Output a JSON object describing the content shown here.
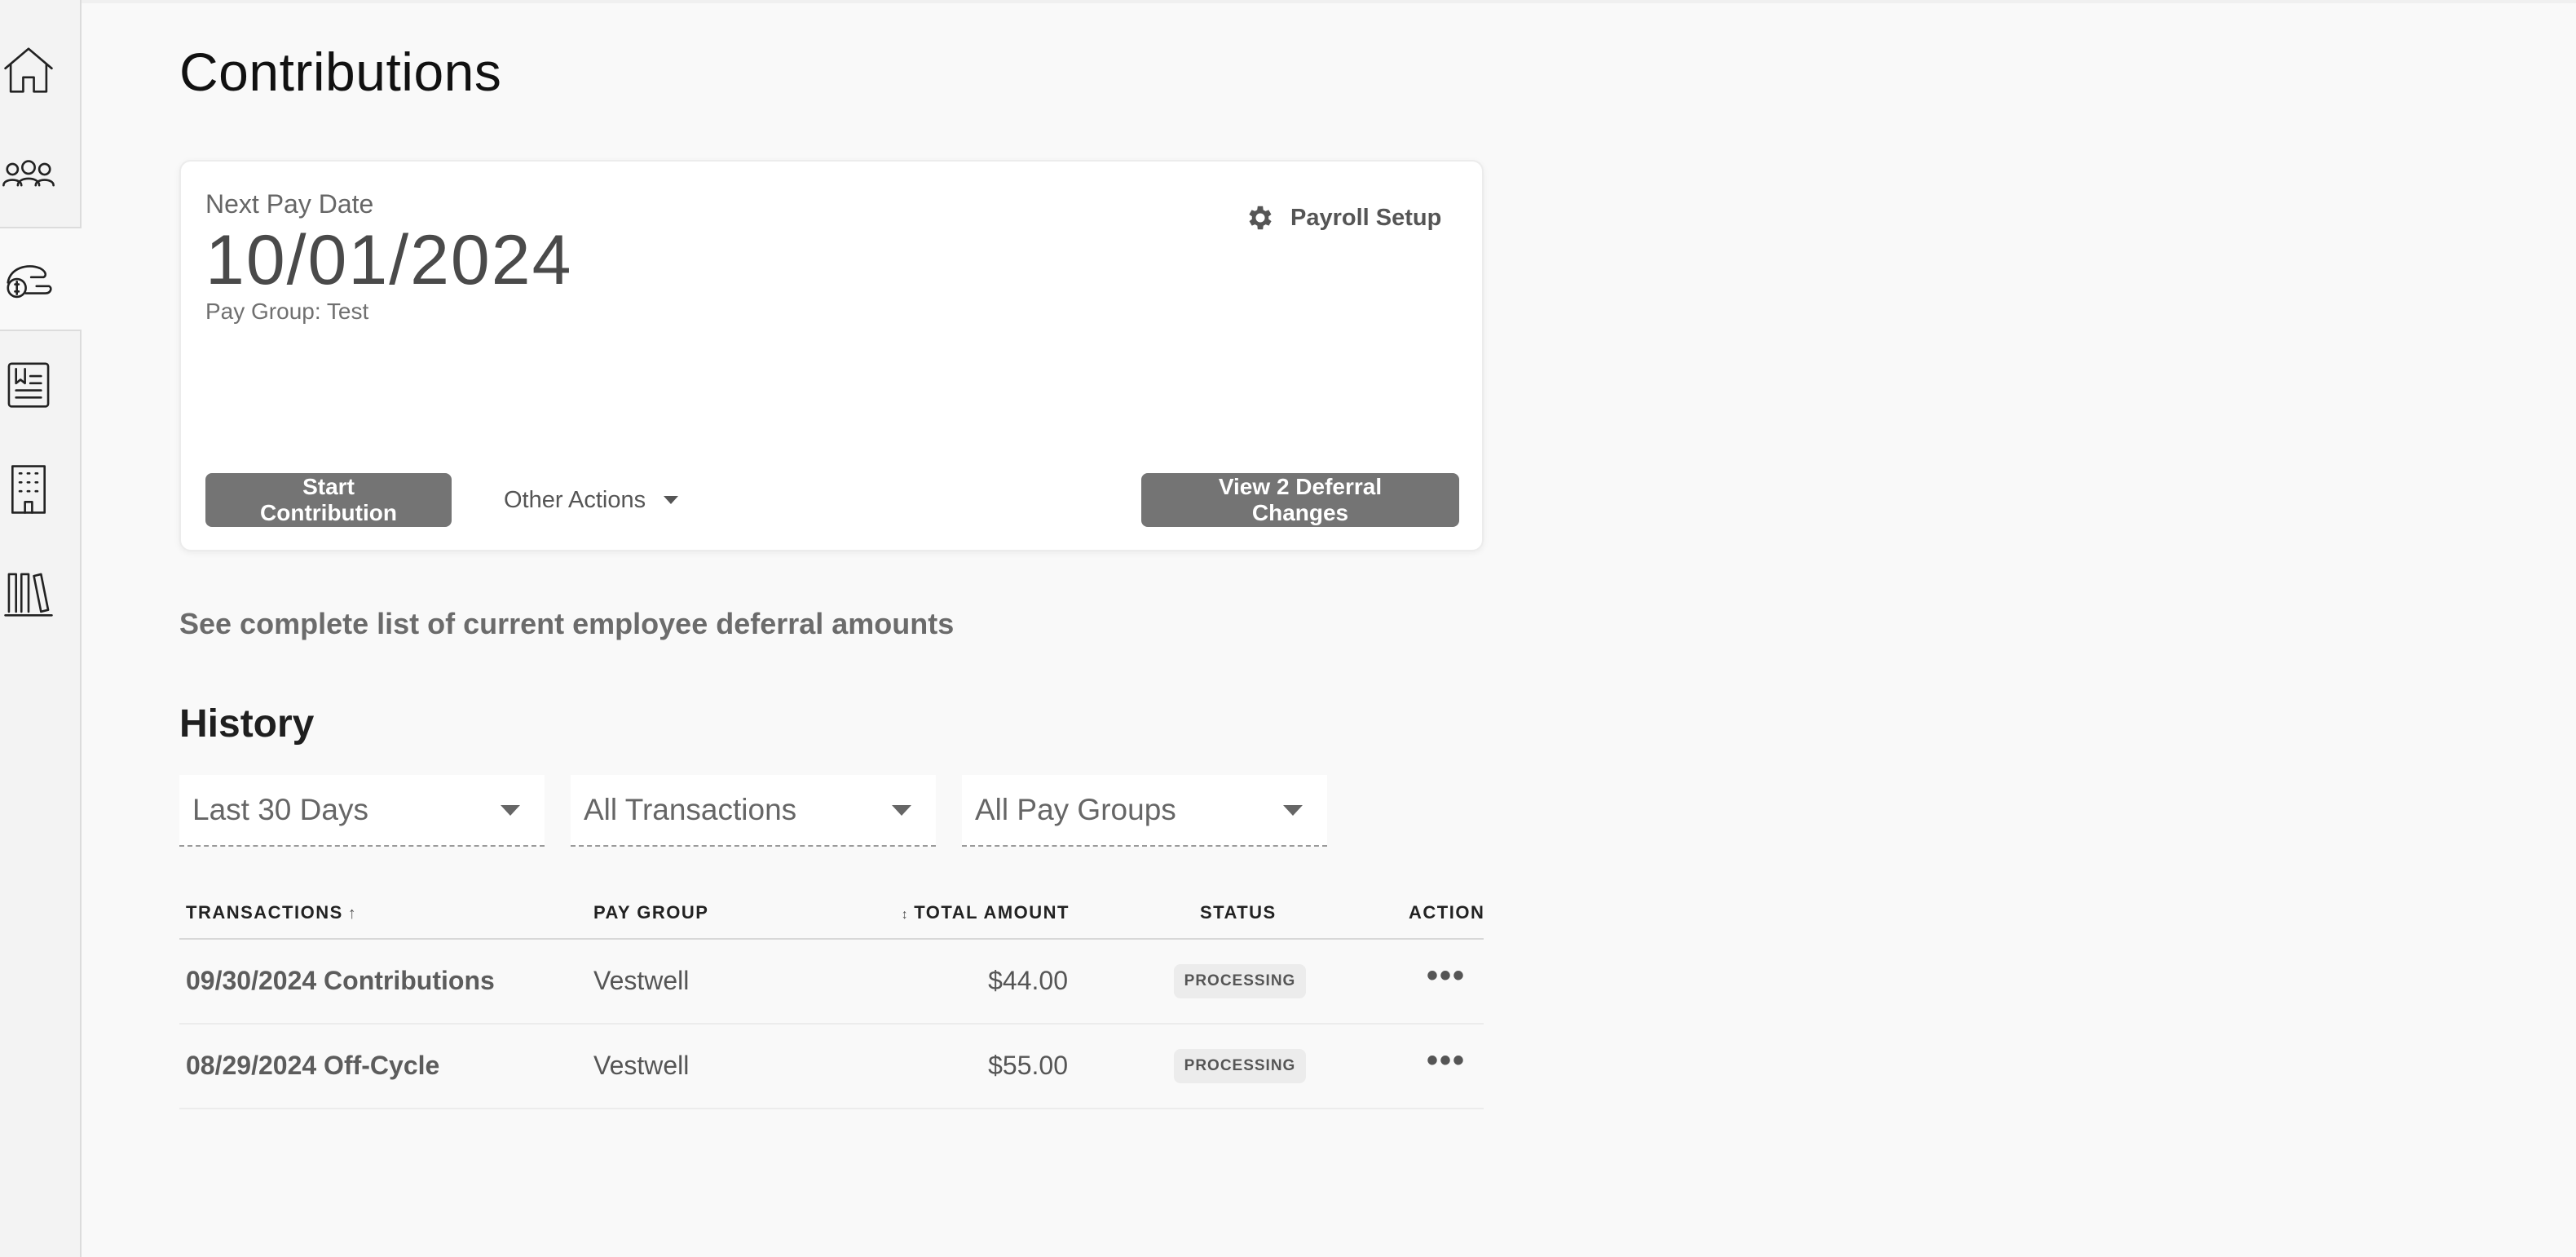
{
  "page": {
    "title": "Contributions"
  },
  "sidebar": {
    "items": [
      {
        "icon": "home-icon"
      },
      {
        "icon": "people-icon"
      },
      {
        "icon": "contributions-icon",
        "active": true
      },
      {
        "icon": "document-icon"
      },
      {
        "icon": "building-icon"
      },
      {
        "icon": "library-icon"
      }
    ]
  },
  "card": {
    "next_pay_label": "Next Pay Date",
    "next_pay_date": "10/01/2024",
    "pay_group": "Pay Group: Test",
    "payroll_setup_label": "Payroll Setup",
    "start_contribution_label": "Start Contribution",
    "other_actions_label": "Other Actions",
    "view_deferral_label": "View 2 Deferral Changes"
  },
  "deferral_link": "See complete list of current employee deferral amounts",
  "history": {
    "title": "History",
    "filters": {
      "period": "Last 30 Days",
      "transactions": "All Transactions",
      "pay_groups": "All Pay Groups"
    },
    "columns": {
      "transactions": "TRANSACTIONS",
      "pay_group": "PAY GROUP",
      "total_amount": "TOTAL AMOUNT",
      "status": "STATUS",
      "action": "ACTION"
    },
    "rows": [
      {
        "transaction": "09/30/2024 Contributions",
        "pay_group": "Vestwell",
        "amount": "$44.00",
        "status": "PROCESSING",
        "action": "•••"
      },
      {
        "transaction": "08/29/2024 Off-Cycle",
        "pay_group": "Vestwell",
        "amount": "$55.00",
        "status": "PROCESSING",
        "action": "•••"
      }
    ]
  },
  "colors": {
    "button_bg": "#747474",
    "page_bg": "#f9f9f9",
    "sidebar_bg": "#f3f3f3"
  }
}
